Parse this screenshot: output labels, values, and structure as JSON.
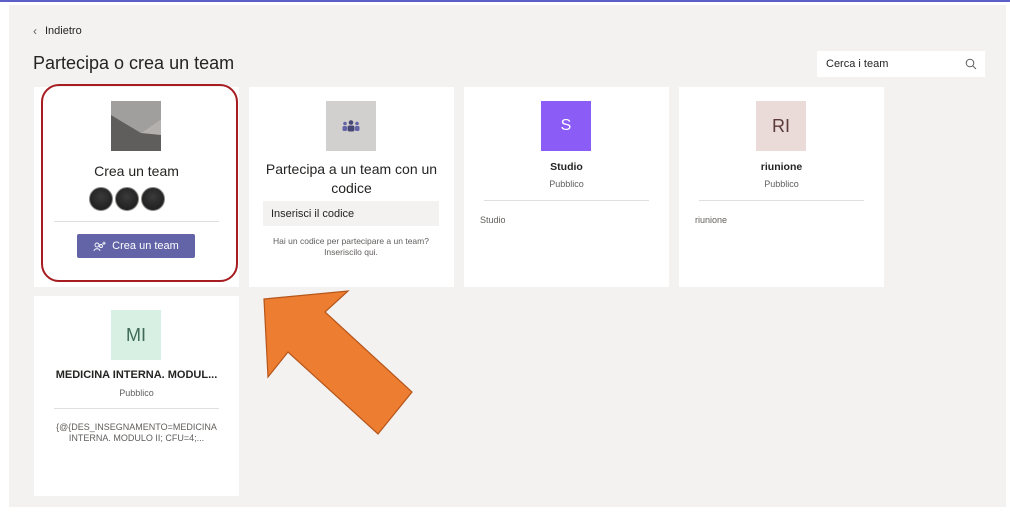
{
  "nav": {
    "back_label": "Indietro"
  },
  "page": {
    "title": "Partecipa o crea un team"
  },
  "search": {
    "placeholder": "Cerca i team"
  },
  "create_card": {
    "title": "Crea un team",
    "button_label": "Crea un team"
  },
  "join_card": {
    "title": "Partecipa a un team con un codice",
    "input_placeholder": "Inserisci il codice",
    "hint": "Hai un codice per partecipare a un team? Inseriscilo qui."
  },
  "teams": [
    {
      "initials": "S",
      "name": "Studio",
      "type": "Pubblico",
      "description": "Studio",
      "color": "#8b5cf6"
    },
    {
      "initials": "RI",
      "name": "riunione",
      "type": "Pubblico",
      "description": "riunione",
      "color": "#eadad8"
    },
    {
      "initials": "MI",
      "name": "MEDICINA INTERNA. MODUL...",
      "type": "Pubblico",
      "description": "{@{DES_INSEGNAMENTO=MEDICINA INTERNA. MODULO II; CFU=4;...",
      "color": "#d8efe3"
    }
  ],
  "colors": {
    "accent": "#6264a7",
    "highlight_ring": "#a61c20",
    "arrow": "#ed7d31"
  },
  "icons": {
    "back": "chevron-left-icon",
    "search": "search-icon",
    "join": "team-people-icon",
    "create": "add-team-icon"
  }
}
